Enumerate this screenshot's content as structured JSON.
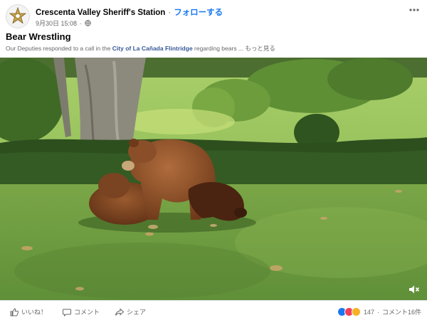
{
  "post": {
    "page_name": "Crescenta Valley Sheriff's Station",
    "separator": "·",
    "follow_label": "フォローする",
    "date": "9月30日 15:08",
    "meta_separator": "·",
    "more_icon": "more-horizontal-icon",
    "title": "Bear Wrestling",
    "description_before": "Our Deputies responded to a call in the ",
    "description_link": "City of La Cañada Flintridge",
    "description_after": " regarding bears ...",
    "see_more": "もっと見る"
  },
  "video": {
    "mute_icon": "speaker-muted-icon"
  },
  "footer": {
    "like_label": "いいね！",
    "comment_label": "コメント",
    "share_label": "シェア",
    "reaction_count": "147",
    "separator": "·",
    "comment_count": "コメント16件"
  },
  "colors": {
    "accent": "#1877f2",
    "link": "#385898",
    "like": "#1877f2",
    "love": "#f33e58",
    "wow": "#f7b125"
  }
}
